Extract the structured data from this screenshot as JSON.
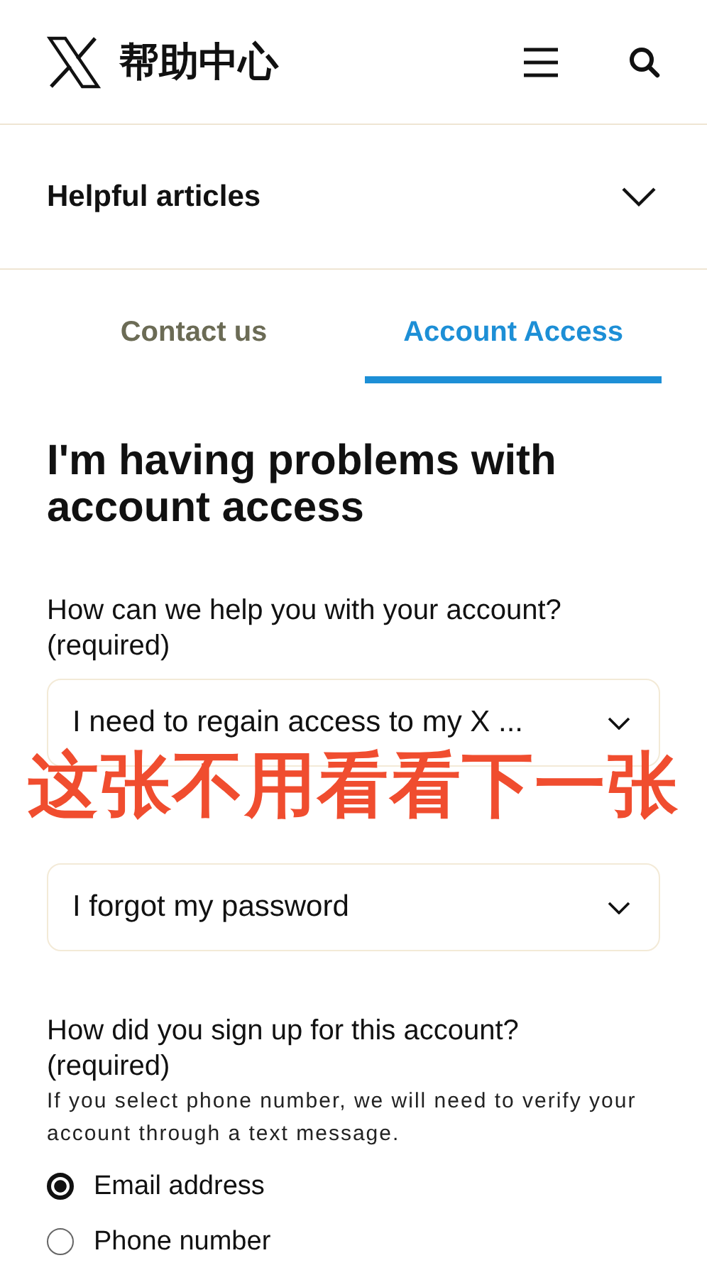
{
  "header": {
    "title": "帮助中心"
  },
  "helpful_articles": {
    "label": "Helpful articles",
    "expanded": false
  },
  "tabs": [
    {
      "label": "Contact us",
      "selected": false
    },
    {
      "label": "Account Access",
      "selected": true
    }
  ],
  "heading": "I'm having problems with account access",
  "question_1": {
    "label": "How can we help you with your account?",
    "required": "(required)",
    "value": "I need to regain access to my X ..."
  },
  "question_2": {
    "value": "I forgot my password"
  },
  "question_3": {
    "label": "How did you sign up for this account?",
    "required": "(required)",
    "hint": "If you select phone number, we will need to verify your account through a text message.",
    "options": [
      {
        "label": "Email address",
        "selected": true
      },
      {
        "label": "Phone number",
        "selected": false
      }
    ]
  },
  "overlay_caption": "这张不用看看下一张"
}
